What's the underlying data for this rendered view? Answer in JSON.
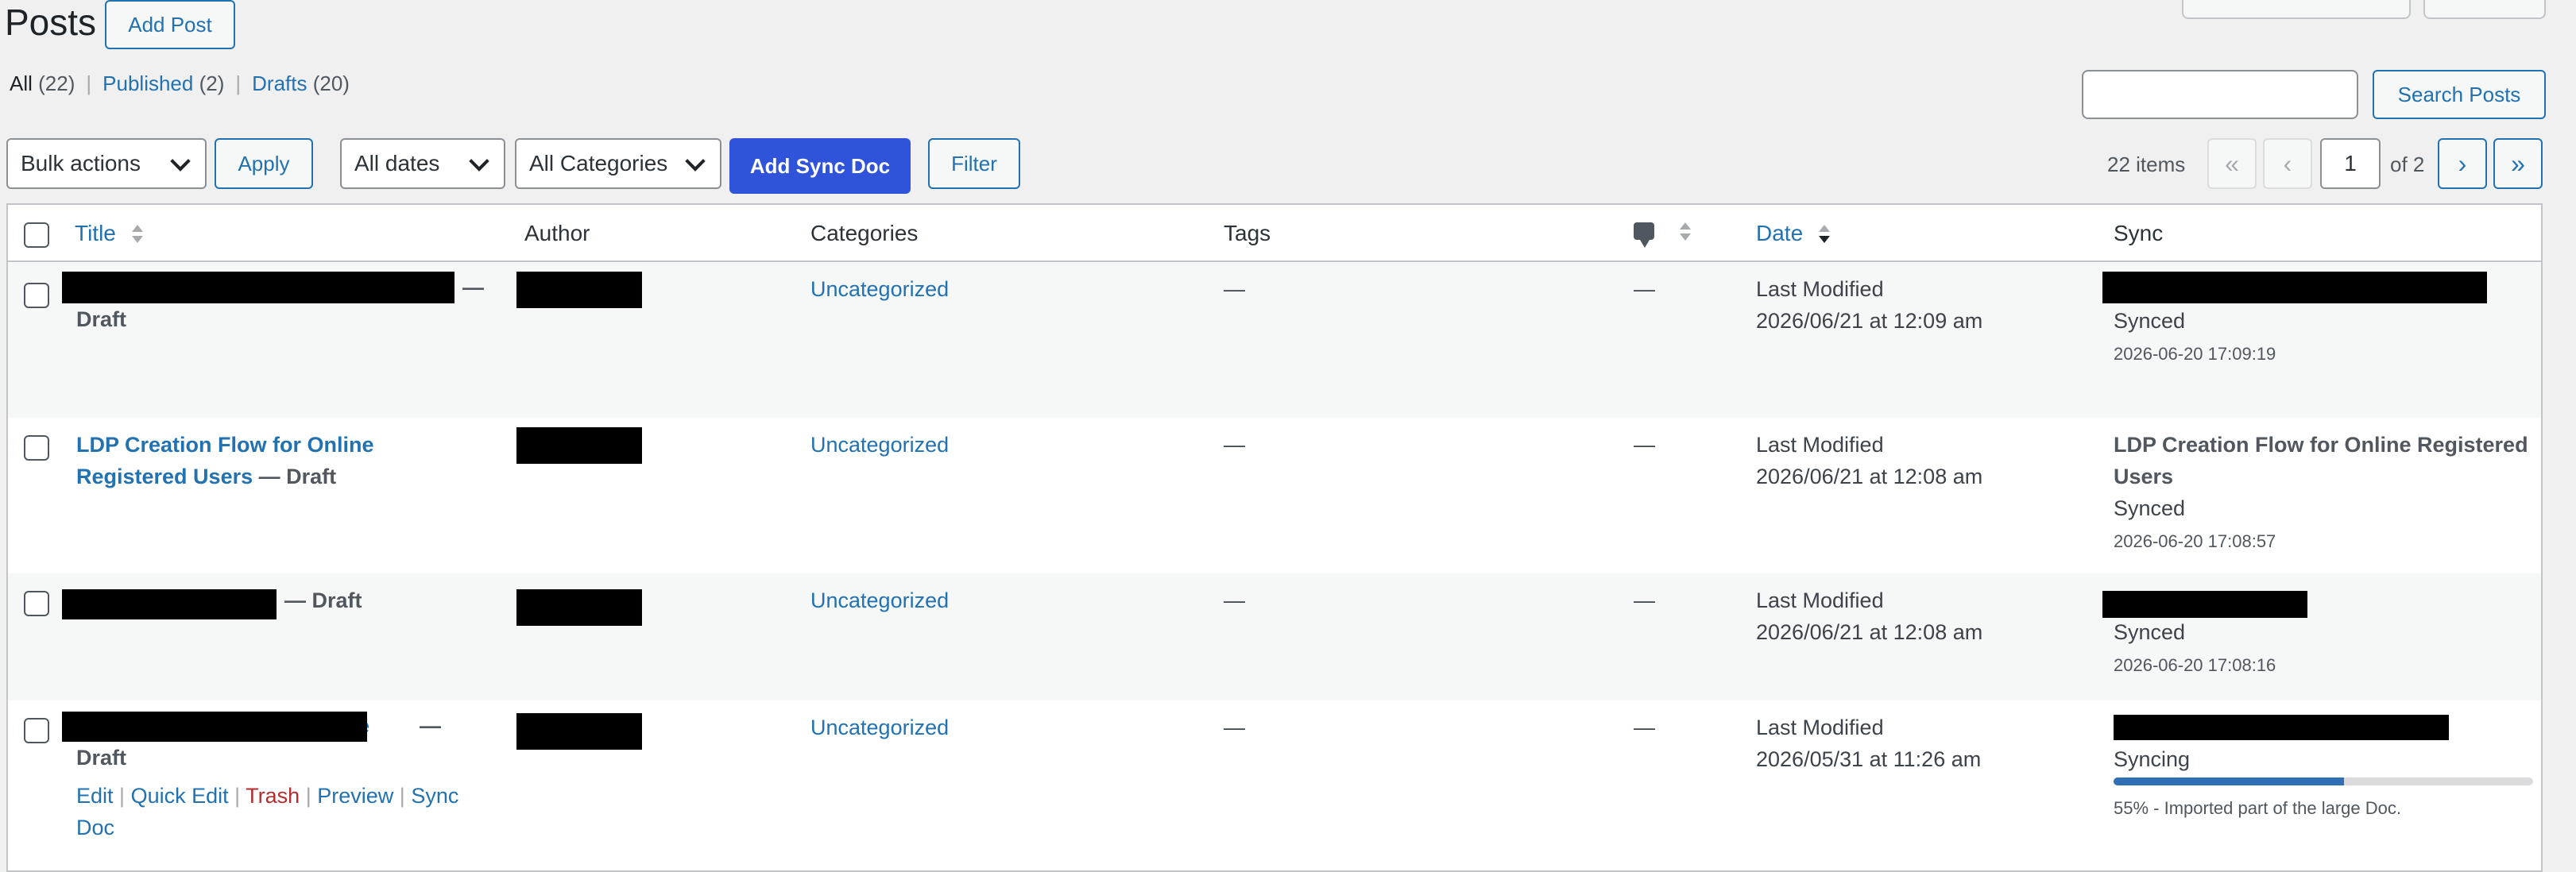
{
  "header": {
    "title": "Posts",
    "add_post_label": "Add Post"
  },
  "views": {
    "all_label": "All",
    "all_count": "(22)",
    "published_label": "Published",
    "published_count": "(2)",
    "drafts_label": "Drafts",
    "drafts_count": "(20)"
  },
  "search": {
    "value": "",
    "button_label": "Search Posts"
  },
  "tablenav": {
    "bulk_actions": "Bulk actions",
    "apply_label": "Apply",
    "date_filter": "All dates",
    "category_filter": "All Categories",
    "add_sync_doc_label": "Add Sync Doc",
    "filter_label": "Filter",
    "items_count": "22 items",
    "first_page": "«",
    "prev_page": "‹",
    "current_page": "1",
    "of_pages": "of 2",
    "next_page": "›",
    "last_page": "»"
  },
  "columns": {
    "title": "Title",
    "author": "Author",
    "categories": "Categories",
    "tags": "Tags",
    "date": "Date",
    "sync": "Sync"
  },
  "rows": [
    {
      "title_suffix": "—",
      "state": "Draft",
      "category": "Uncategorized",
      "tags": "—",
      "comments": "—",
      "date_label": "Last Modified",
      "date_value": "2026/06/21 at 12:09 am",
      "sync_status": "Synced",
      "sync_time": "2026-06-20 17:09:19"
    },
    {
      "title_line1": "LDP Creation Flow for Online",
      "title_line2": "Registered Users",
      "title_suffix": "— Draft",
      "category": "Uncategorized",
      "tags": "—",
      "comments": "—",
      "date_label": "Last Modified",
      "date_value": "2026/06/21 at 12:08 am",
      "sync_title_line1": "LDP Creation Flow for Online Registered",
      "sync_title_line2": "Users",
      "sync_status": "Synced",
      "sync_time": "2026-06-20 17:08:57"
    },
    {
      "title_suffix": "— Draft",
      "category": "Uncategorized",
      "tags": "—",
      "comments": "—",
      "date_label": "Last Modified",
      "date_value": "2026/06/21 at 12:08 am",
      "sync_status": "Synced",
      "sync_time": "2026-06-20 17:08:16"
    },
    {
      "title_partial": "e",
      "title_suffix": "—",
      "state": "Draft",
      "category": "Uncategorized",
      "tags": "—",
      "comments": "—",
      "date_label": "Last Modified",
      "date_value": "2026/05/31 at 11:26 am",
      "sync_status": "Syncing",
      "sync_progress": 0.55,
      "sync_message": "55% - Imported part of the large Doc.",
      "actions": {
        "edit": "Edit",
        "quick_edit": "Quick Edit",
        "trash": "Trash",
        "preview": "Preview",
        "sync_line1": "Sync",
        "sync_line2": "Doc",
        "sep": "|"
      }
    }
  ],
  "colors": {
    "link": "#2271b1",
    "primary_button": "#2f53d9",
    "trash": "#b32d2e",
    "progress_fill": "#2f6fb5"
  }
}
